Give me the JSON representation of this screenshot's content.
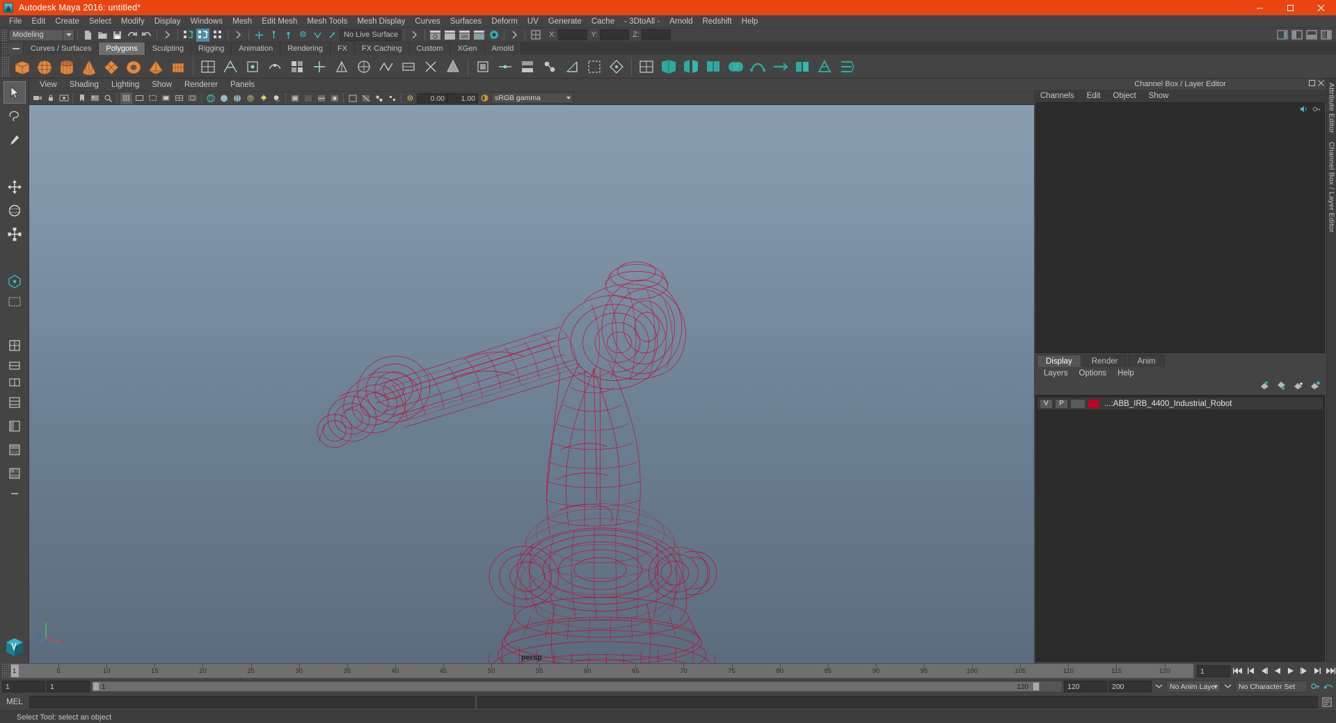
{
  "window": {
    "title": "Autodesk Maya 2016: untitled*",
    "logo_icon": "maya-logo-icon",
    "minimize_icon": "minimize-icon",
    "maximize_icon": "maximize-icon",
    "close_icon": "close-icon",
    "accent_color": "#e74610"
  },
  "menubar": {
    "items": [
      "File",
      "Edit",
      "Create",
      "Select",
      "Modify",
      "Display",
      "Windows",
      "Mesh",
      "Edit Mesh",
      "Mesh Tools",
      "Mesh Display",
      "Curves",
      "Surfaces",
      "Deform",
      "UV",
      "Generate",
      "Cache",
      "- 3DtoAll -",
      "Arnold",
      "Redshift",
      "Help"
    ]
  },
  "toolbar": {
    "menu_set": "Modeling",
    "live_surface": "No Live Surface",
    "coord": {
      "x_label": "X:",
      "y_label": "Y:",
      "z_label": "Z:",
      "x_value": "",
      "y_value": "",
      "z_value": ""
    },
    "icons": [
      "new-scene-icon",
      "open-scene-icon",
      "save-scene-icon",
      "undo-icon",
      "redo-icon",
      "select-by-hierarchy-icon",
      "select-by-object-icon",
      "select-by-component-icon",
      "snap-to-grid-icon",
      "snap-to-curve-icon",
      "snap-to-point-icon",
      "snap-to-projected-center-icon",
      "snap-to-view-plane-icon",
      "make-live-icon",
      "show-render-view-icon",
      "render-current-frame-icon",
      "ipr-render-icon",
      "render-settings-icon",
      "hypershade-icon",
      "pick-walk-icon"
    ],
    "right_icons": [
      "sidebar-toggle-icon",
      "attribute-editor-toggle-icon",
      "tool-settings-toggle-icon",
      "channel-box-toggle-icon"
    ]
  },
  "shelf": {
    "tabs": [
      "Curves / Surfaces",
      "Polygons",
      "Sculpting",
      "Rigging",
      "Animation",
      "Rendering",
      "FX",
      "FX Caching",
      "Custom",
      "XGen",
      "Arnold"
    ],
    "active_tab": "Polygons",
    "buttons": [
      "polygon-cube",
      "polygon-sphere",
      "polygon-cylinder",
      "polygon-cone",
      "polygon-plane",
      "polygon-torus",
      "polygon-pyramid",
      "polygon-prism",
      "combine-mesh",
      "separate-mesh",
      "extract-mesh",
      "booleans-union",
      "smooth-mesh",
      "reduce-mesh",
      "quadrangulate",
      "triangulate",
      "create-polygon-tool",
      "append-polygon-tool",
      "multi-cut-tool",
      "target-weld-tool",
      "bevel",
      "bridge",
      "extrude",
      "merge",
      "fill-hole",
      "mirror-geometry",
      "crease-tool",
      "uv-editor",
      "sculpt-tool",
      "wedge",
      "offset-edge-loop",
      "paint-selection",
      "poke-face",
      "chamfer-vertex",
      "duplicate-face",
      "connect-components",
      "detach-component"
    ]
  },
  "tools": {
    "items": [
      {
        "name": "select-tool",
        "selected": true
      },
      {
        "name": "lasso-select-tool",
        "selected": false
      },
      {
        "name": "paint-select-tool",
        "selected": false
      },
      {
        "name": "move-tool",
        "selected": false
      },
      {
        "name": "rotate-tool",
        "selected": false
      },
      {
        "name": "scale-tool",
        "selected": false
      },
      {
        "name": "universal-manipulator-tool",
        "selected": false
      },
      {
        "name": "soft-modification-tool",
        "selected": false
      },
      {
        "name": "show-manipulator-tool",
        "selected": false
      },
      {
        "name": "last-tool-used",
        "selected": false
      },
      {
        "name": "single-pane-layout",
        "selected": false
      },
      {
        "name": "two-pane-side-layout",
        "selected": false
      },
      {
        "name": "two-pane-stacked-layout",
        "selected": false
      },
      {
        "name": "four-pane-layout",
        "selected": false
      },
      {
        "name": "persp-outliner-layout",
        "selected": false
      },
      {
        "name": "persp-graph-layout",
        "selected": false
      },
      {
        "name": "hypershade-persp-layout",
        "selected": false
      },
      {
        "name": "expand-bookmarks",
        "selected": false
      }
    ],
    "cube_icon": "maya-cube-icon"
  },
  "viewport": {
    "menus": [
      "View",
      "Shading",
      "Lighting",
      "Show",
      "Renderer",
      "Panels"
    ],
    "toolbar_icons": [
      "select-camera-icon",
      "lock-camera-icon",
      "camera-attributes-icon",
      "bookmark-icon",
      "image-plane-icon",
      "two-d-pan-zoom-icon",
      "grid-toggle-icon",
      "film-gate-icon",
      "resolution-gate-icon",
      "gate-mask-icon",
      "field-chart-icon",
      "safe-action-icon",
      "safe-title-icon",
      "wireframe-icon",
      "smooth-shade-icon",
      "shaded-wireframe-icon",
      "texture-toggle-icon",
      "use-all-lights-icon",
      "shadows-icon",
      "screen-space-ao-icon",
      "motion-blur-icon",
      "multisample-icon",
      "depth-of-field-icon",
      "isolate-select-icon",
      "xray-icon",
      "xray-joints-icon",
      "xray-active-components-icon",
      "exposure-icon",
      "gamma-icon"
    ],
    "exposure_value": "0.00",
    "gamma_value": "1.00",
    "color_management": "sRGB gamma",
    "camera_label": "persp",
    "axis_labels": {
      "y": "Y",
      "z": "Z",
      "x": "X"
    },
    "bg_top_color": "#8a9eb0",
    "bg_bottom_color": "#5b6c7d",
    "model_color": "#c8002e",
    "model_name": "ABB_IRB_4400_Industrial_Robot"
  },
  "right_dock": {
    "panel_title": "Channel Box / Layer Editor",
    "float_icon": "float-panel-icon",
    "close_icon": "close-panel-icon",
    "channel_tabs": [
      "Channels",
      "Edit",
      "Object",
      "Show"
    ],
    "channel_icons": [
      "speaker-icon",
      "key-icon"
    ],
    "layer_editor_tabs": [
      "Display",
      "Render",
      "Anim"
    ],
    "layer_editor_active_tab": "Display",
    "layer_menus": [
      "Layers",
      "Options",
      "Help"
    ],
    "layer_tool_icons": [
      "move-layer-up-icon",
      "move-layer-down-icon",
      "new-layer-icon",
      "new-layer-from-selected-icon"
    ],
    "layers": [
      {
        "visibility": "V",
        "playback": "P",
        "type": "",
        "color": "#c20028",
        "name": "...:ABB_IRB_4400_Industrial_Robot"
      }
    ],
    "vertical_tabs": [
      "Attribute Editor",
      "Channel Box / Layer Editor"
    ]
  },
  "time_slider": {
    "current_frame": "1",
    "ticks": [
      5,
      10,
      15,
      20,
      25,
      30,
      35,
      40,
      45,
      50,
      55,
      60,
      65,
      70,
      75,
      80,
      85,
      90,
      95,
      100,
      105,
      110,
      115,
      120
    ],
    "frame_field": "1",
    "playback_icons": [
      "go-to-start-icon",
      "step-back-keyframe-icon",
      "step-back-frame-icon",
      "play-backwards-icon",
      "play-forwards-icon",
      "step-forward-frame-icon",
      "step-forward-keyframe-icon",
      "go-to-end-icon"
    ]
  },
  "range_bar": {
    "start": "1",
    "end": "1",
    "range_start_label": "1",
    "range_end_label": "120",
    "playback_end": "120",
    "anim_end": "200",
    "anim_layer": "No Anim Layer",
    "character_set": "No Character Set",
    "auto_key_icon": "auto-keyframe-icon",
    "anim_prefs_icon": "animation-preferences-icon"
  },
  "mel_bar": {
    "label": "MEL",
    "command_value": "",
    "output_value": "",
    "script_editor_icon": "script-editor-icon"
  },
  "status_bar": {
    "message": "Select Tool: select an object"
  }
}
